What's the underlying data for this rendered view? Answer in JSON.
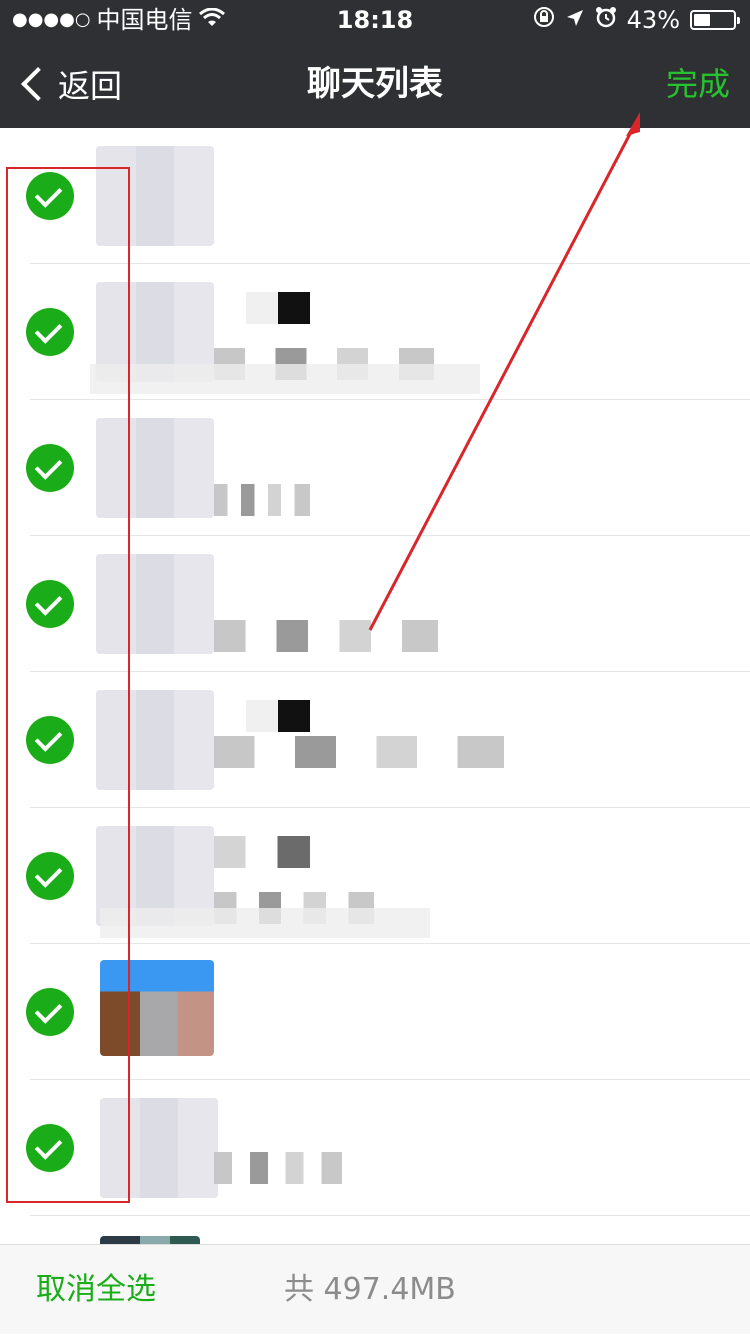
{
  "status_bar": {
    "carrier": "中国电信",
    "time": "18:18",
    "battery": "43%",
    "icons": [
      "signal-dots-icon",
      "wifi-icon",
      "rotation-lock-icon",
      "location-arrow-icon",
      "alarm-icon",
      "battery-icon"
    ]
  },
  "nav": {
    "back_label": "返回",
    "title": "聊天列表",
    "done_label": "完成"
  },
  "list": {
    "rows": [
      {
        "selected": true
      },
      {
        "selected": true
      },
      {
        "selected": true
      },
      {
        "selected": true
      },
      {
        "selected": true
      },
      {
        "selected": true
      },
      {
        "selected": true
      },
      {
        "selected": true
      }
    ]
  },
  "bottom": {
    "deselect_all_label": "取消全选",
    "total_label": "共 497.4MB"
  },
  "colors": {
    "bar_bg": "#2f3034",
    "accent_green": "#1aad19",
    "annotation_red": "#d8262b"
  }
}
